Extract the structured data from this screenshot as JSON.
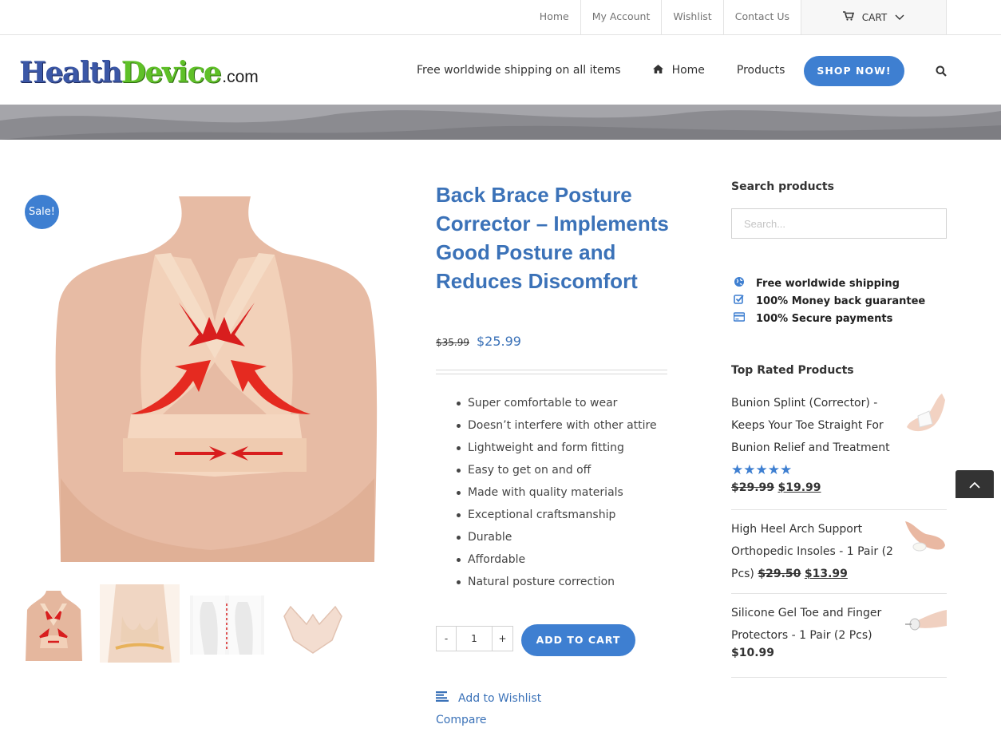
{
  "topbar": {
    "links": [
      "Home",
      "My Account",
      "Wishlist",
      "Contact Us"
    ],
    "cart_label": "CART"
  },
  "header": {
    "logo": {
      "part1": "Health",
      "part2": "Device",
      "part3": ".com"
    },
    "shipping_text": "Free worldwide shipping on all items",
    "nav_home": "Home",
    "nav_products": "Products",
    "shop_button": "SHOP NOW!"
  },
  "product": {
    "sale_badge": "Sale!",
    "title": "Back Brace Posture Corrector – Implements Good Posture and Reduces Discomfort",
    "old_price": "$35.99",
    "price": "$25.99",
    "features": [
      "Super comfortable to wear",
      "Doesn’t interfere with other attire",
      "Lightweight and form fitting",
      "Easy to get on and off",
      "Made with quality materials",
      "Exceptional craftsmanship",
      "Durable",
      "Affordable",
      "Natural posture correction"
    ],
    "qty_minus": "-",
    "qty_value": "1",
    "qty_plus": "+",
    "add_to_cart": "ADD TO CART",
    "wishlist": "Add to Wishlist",
    "compare": "Compare"
  },
  "sidebar": {
    "search_title": "Search products",
    "search_placeholder": "Search...",
    "perks": [
      "Free worldwide shipping",
      "100% Money back guarantee",
      "100% Secure payments"
    ],
    "top_rated_title": "Top Rated Products",
    "top_rated": [
      {
        "name": "Bunion Splint (Corrector) - Keeps Your Toe Straight For Bunion Relief and Treatment",
        "rating": 5,
        "old_price": "$29.99",
        "price": "$19.99"
      },
      {
        "name": "High Heel Arch Support Orthopedic Insoles - 1 Pair (2 Pcs)",
        "old_price": "$29.50",
        "price": "$13.99"
      },
      {
        "name": "Silicone Gel Toe and Finger Protectors - 1 Pair (2 Pcs)",
        "price": "$10.99"
      }
    ]
  },
  "colors": {
    "accent": "#3e7fd1",
    "title": "#3b72b8",
    "logo_blue": "#3b57a6",
    "logo_green": "#5fc028"
  }
}
